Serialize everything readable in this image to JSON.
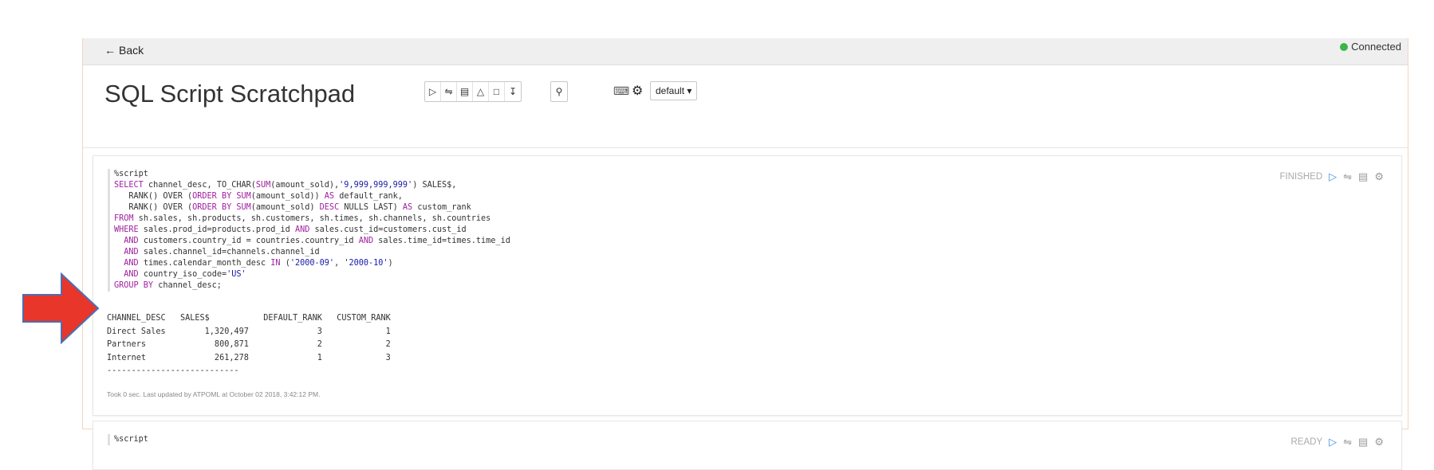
{
  "topbar": {
    "back_label": "Back",
    "status": "Connected",
    "status_color": "#3cb44b"
  },
  "header": {
    "title": "SQL Script Scratchpad",
    "toolbar1_icons": [
      "run-icon",
      "expand-icon",
      "book-icon",
      "eraser-icon",
      "trash-icon",
      "download-icon"
    ],
    "toolbar2_icons": [
      "search-icon"
    ],
    "interpreter_select": "default"
  },
  "paragraphs": [
    {
      "status": "FINISHED",
      "code_lines": [
        "%script",
        "SELECT channel_desc, TO_CHAR(SUM(amount_sold),'9,999,999,999') SALES$,",
        "   RANK() OVER (ORDER BY SUM(amount_sold)) AS default_rank,",
        "   RANK() OVER (ORDER BY SUM(amount_sold) DESC NULLS LAST) AS custom_rank",
        "FROM sh.sales, sh.products, sh.customers, sh.times, sh.channels, sh.countries",
        "WHERE sales.prod_id=products.prod_id AND sales.cust_id=customers.cust_id",
        "  AND customers.country_id = countries.country_id AND sales.time_id=times.time_id",
        "  AND sales.channel_id=channels.channel_id",
        "  AND times.calendar_month_desc IN ('2000-09', '2000-10')",
        "  AND country_iso_code='US'",
        "GROUP BY channel_desc;"
      ],
      "output_lines": [
        "CHANNEL_DESC   SALES$           DEFAULT_RANK   CUSTOM_RANK",
        "Direct Sales        1,320,497              3             1",
        "Partners              800,871              2             2",
        "Internet              261,278              1             3",
        "---------------------------"
      ],
      "footer": "Took 0 sec. Last updated by ATPOML at October 02 2018, 3:42:12 PM."
    },
    {
      "status": "READY",
      "code_lines": [
        "%script"
      ]
    }
  ],
  "colors": {
    "keyword": "#a020a0",
    "string": "#1a1aa6",
    "accent": "#3f8de0",
    "arrow_fill": "#e8362a",
    "arrow_stroke": "#4a6fb5"
  }
}
